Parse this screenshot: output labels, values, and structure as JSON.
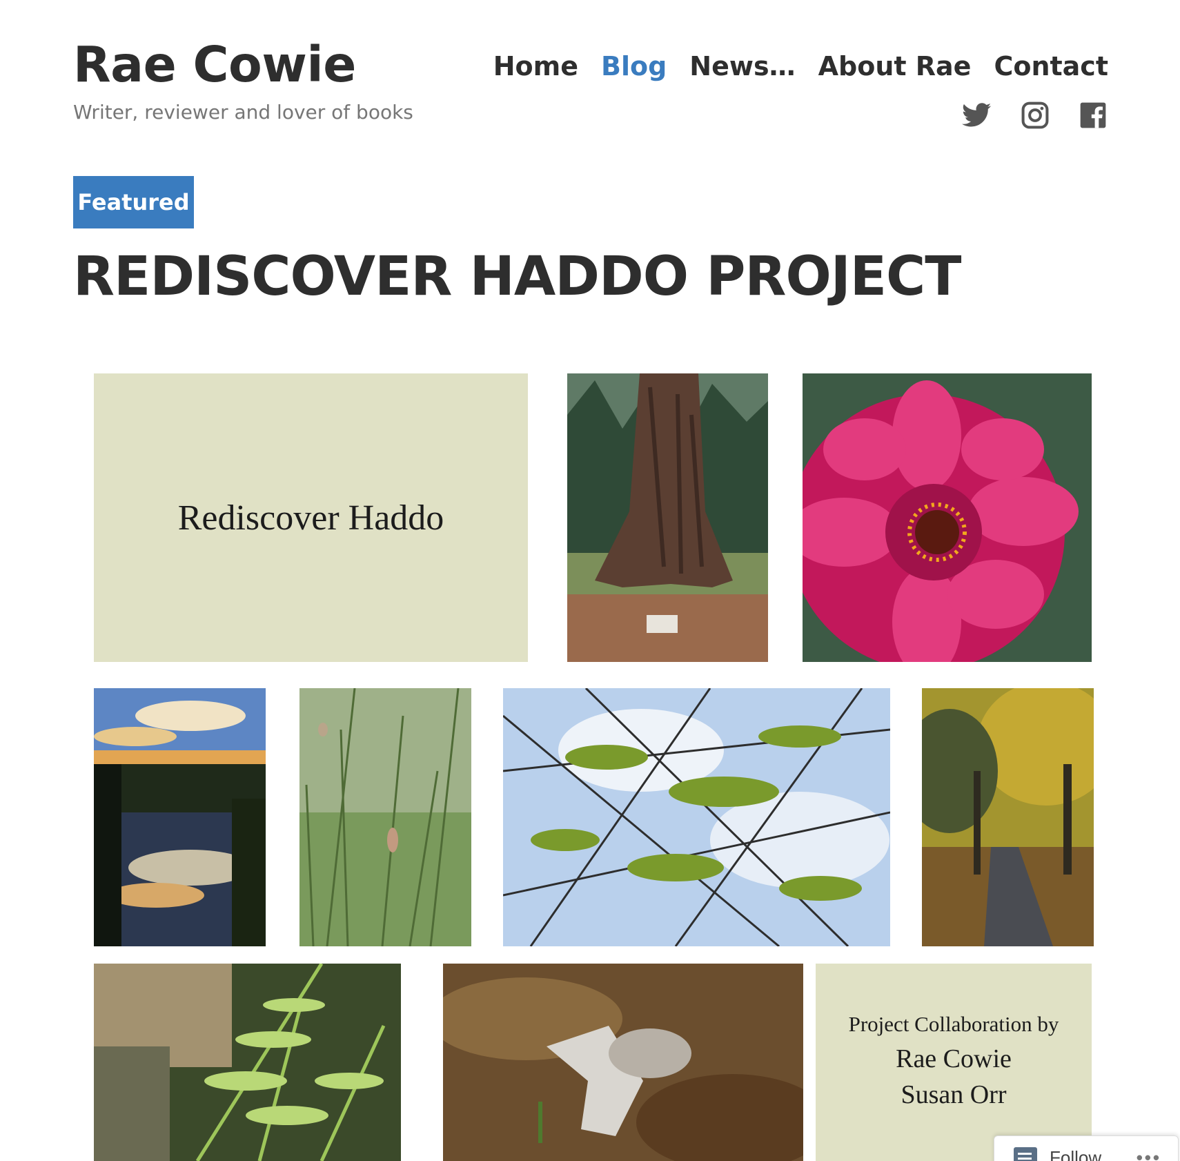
{
  "site": {
    "title": "Rae Cowie",
    "tagline": "Writer, reviewer and lover of books"
  },
  "nav": {
    "items": [
      "Home",
      "Blog",
      "News…",
      "About Rae",
      "Contact"
    ],
    "active": "Blog"
  },
  "social": [
    "twitter-icon",
    "instagram-icon",
    "facebook-icon"
  ],
  "post": {
    "badge": "Featured",
    "title": "REDISCOVER HADDO PROJECT"
  },
  "gallery": {
    "title_tile": "Rediscover Haddo",
    "collab_line": "Project Collaboration by",
    "collab_names": [
      "Rae Cowie",
      "Susan Orr"
    ]
  },
  "follow": {
    "label": "Follow",
    "more": "•••"
  },
  "colors": {
    "accent": "#3a7cbf",
    "tile_background": "#e0e1c5",
    "text": "#2e2e2e"
  }
}
